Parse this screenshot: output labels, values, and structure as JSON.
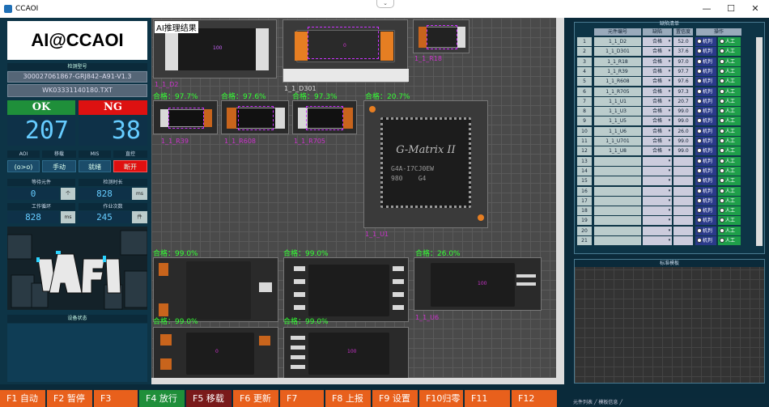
{
  "window": {
    "title": "CCAOI",
    "minimize": "—",
    "maximize": "☐",
    "close": "✕",
    "chevron": "⌄"
  },
  "left": {
    "brand": "AI@CCAOI",
    "program_header": "检测型号",
    "program_name": "300027061867-GRJ842–A91-V1.3",
    "file_name": "WK03331140180.TXT",
    "ok_label": "OK",
    "ng_label": "NG",
    "ok_count": "207",
    "ng_count": "38",
    "mode_labels": [
      "AOI",
      "移载",
      "MIS",
      "直控"
    ],
    "mode_buttons": [
      "(o>o)",
      "手动",
      "就绪",
      "断开"
    ],
    "wait_label": "等待元件",
    "wait_value": "0",
    "wait_unit": "个",
    "detect_time_label": "检测时长",
    "detect_time_value": "828",
    "detect_time_unit": "ms",
    "cycle_label": "工作循环",
    "cycle_value": "828",
    "cycle_unit": "ms",
    "jobs_label": "作业次数",
    "jobs_value": "245",
    "jobs_unit": "件",
    "device_status_label": "设备状态"
  },
  "center": {
    "ai_title": "AI推理结果",
    "thumbs": [
      {
        "pass": "",
        "name": "1_1_D2"
      },
      {
        "pass": "",
        "name": "1_1_D301"
      },
      {
        "pass": "",
        "name": "1_1_R18"
      },
      {
        "pass": "合格：97.7%",
        "name": "1_1_R39"
      },
      {
        "pass": "合格：97.6%",
        "name": "1_1_R608"
      },
      {
        "pass": "合格：97.3%",
        "name": "1_1_R705"
      },
      {
        "pass": "合格：20.7%",
        "name": "1_1_U1"
      },
      {
        "pass": "合格：99.0%",
        "name": ""
      },
      {
        "pass": "合格：99.0%",
        "name": ""
      },
      {
        "pass": "合格：26.0%",
        "name": "1_1_U6"
      },
      {
        "pass": "合格：99.0%",
        "name": ""
      },
      {
        "pass": "合格：99.0%",
        "name": ""
      }
    ],
    "chip_text": "G-Matrix II",
    "chip_sub": "G4A-I7CJ0EW",
    "chip_sub2": "980    G4",
    "mark_100": "100",
    "mark_0": "0"
  },
  "right": {
    "table_title": "缺陷清单",
    "headers": [
      "元件编号",
      "缺陷",
      "置信度",
      "操作"
    ],
    "rows": [
      {
        "n": "1",
        "id": "1_1_D2",
        "defect": "合格",
        "conf": "52.0"
      },
      {
        "n": "2",
        "id": "1_1_D301",
        "defect": "合格",
        "conf": "37.6"
      },
      {
        "n": "3",
        "id": "1_1_R18",
        "defect": "合格",
        "conf": "97.0"
      },
      {
        "n": "4",
        "id": "1_1_R39",
        "defect": "合格",
        "conf": "97.7"
      },
      {
        "n": "5",
        "id": "1_1_R608",
        "defect": "合格",
        "conf": "97.6"
      },
      {
        "n": "6",
        "id": "1_1_R705",
        "defect": "合格",
        "conf": "97.3"
      },
      {
        "n": "7",
        "id": "1_1_U1",
        "defect": "合格",
        "conf": "20.7"
      },
      {
        "n": "8",
        "id": "1_1_U3",
        "defect": "合格",
        "conf": "99.0"
      },
      {
        "n": "9",
        "id": "1_1_U5",
        "defect": "合格",
        "conf": "99.0"
      },
      {
        "n": "10",
        "id": "1_1_U6",
        "defect": "合格",
        "conf": "26.0"
      },
      {
        "n": "11",
        "id": "1_1_U701",
        "defect": "合格",
        "conf": "99.0"
      },
      {
        "n": "12",
        "id": "1_1_U8",
        "defect": "合格",
        "conf": "99.0"
      },
      {
        "n": "13",
        "id": "",
        "defect": "",
        "conf": ""
      },
      {
        "n": "14",
        "id": "",
        "defect": "",
        "conf": ""
      },
      {
        "n": "15",
        "id": "",
        "defect": "",
        "conf": ""
      },
      {
        "n": "16",
        "id": "",
        "defect": "",
        "conf": ""
      },
      {
        "n": "17",
        "id": "",
        "defect": "",
        "conf": ""
      },
      {
        "n": "18",
        "id": "",
        "defect": "",
        "conf": ""
      },
      {
        "n": "19",
        "id": "",
        "defect": "",
        "conf": ""
      },
      {
        "n": "20",
        "id": "",
        "defect": "",
        "conf": ""
      },
      {
        "n": "21",
        "id": "",
        "defect": "",
        "conf": ""
      }
    ],
    "op_machine": "机判",
    "op_manual": "人工",
    "std_title": "标准模板",
    "tabs": "元件列表 ╱ 模板信息 ╱"
  },
  "footer": [
    {
      "label": "F1 自动",
      "color": "#e8601c"
    },
    {
      "label": "F2 暂停",
      "color": "#e8601c"
    },
    {
      "label": "F3",
      "color": "#e8601c"
    },
    {
      "label": "F4 放行",
      "color": "#1f8f3a"
    },
    {
      "label": "F5 移载",
      "color": "#7a1a1a"
    },
    {
      "label": "F6 更新",
      "color": "#e8601c"
    },
    {
      "label": "F7",
      "color": "#e8601c"
    },
    {
      "label": "F8 上报",
      "color": "#e8601c"
    },
    {
      "label": "F9 设置",
      "color": "#e8601c"
    },
    {
      "label": "F10归零",
      "color": "#e8601c"
    },
    {
      "label": "F11",
      "color": "#e8601c"
    },
    {
      "label": "F12",
      "color": "#e8601c"
    }
  ]
}
